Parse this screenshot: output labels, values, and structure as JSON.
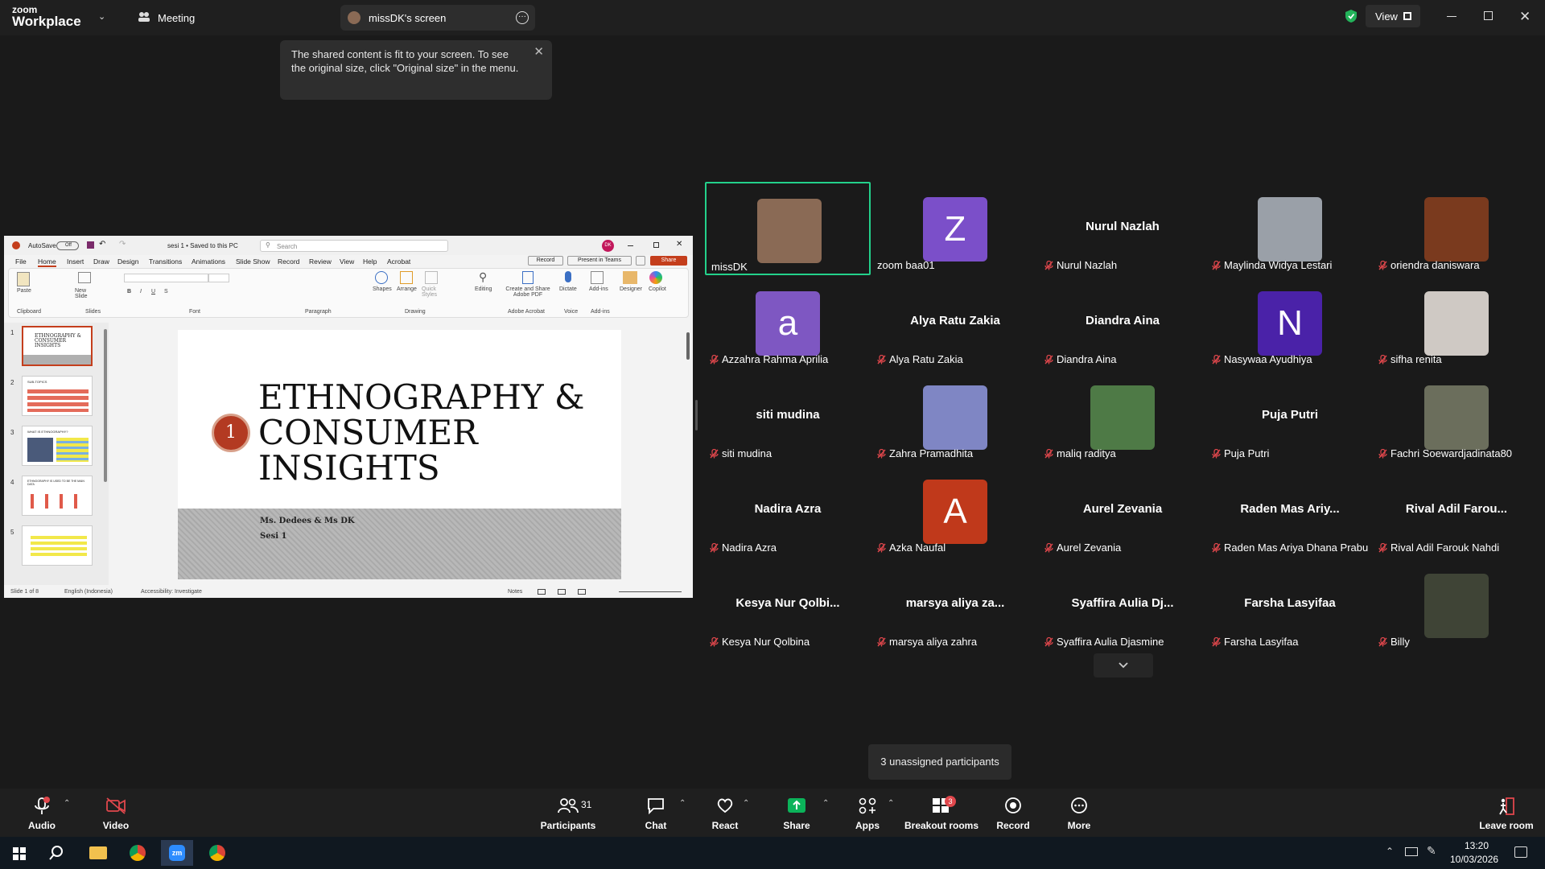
{
  "topbar": {
    "brand_small": "zoom",
    "brand_big": "Workplace",
    "meeting_label": "Meeting",
    "screen_tab": "missDK's screen",
    "view_label": "View"
  },
  "tooltip": {
    "text": "The shared content is fit to your screen. To see the original size, click \"Original size\" in the menu."
  },
  "ppt": {
    "autosave": "AutoSave",
    "autosave_state": "Off",
    "filename": "sesi 1 • Saved to this PC",
    "search_placeholder": "Search",
    "user_initials": "DK",
    "menu": [
      "File",
      "Home",
      "Insert",
      "Draw",
      "Design",
      "Transitions",
      "Animations",
      "Slide Show",
      "Record",
      "Review",
      "View",
      "Help",
      "Acrobat"
    ],
    "record_btn": "Record",
    "present_btn": "Present in Teams",
    "share_btn": "Share",
    "ribbon_groups": [
      "Clipboard",
      "Slides",
      "Font",
      "Paragraph",
      "Drawing",
      "Adobe Acrobat",
      "Voice",
      "Add-ins"
    ],
    "ribbon_buttons": [
      "Paste",
      "New Slide",
      "Shapes",
      "Arrange",
      "Quick Styles",
      "Editing",
      "Create and Share Adobe PDF",
      "Dictate",
      "Add-ins",
      "Designer",
      "Copilot"
    ],
    "thumb_numbers": [
      "1",
      "2",
      "3",
      "4",
      "5"
    ],
    "thumb_titles": [
      "ETHNOGRAPHY & CONSUMER INSIGHTS",
      "SUB-TOPICS",
      "WHAT IS ETHNOGRAPHY?",
      "ETHNOGRAPHY IS USED TO BE THE MAIN DATA",
      ""
    ],
    "slide": {
      "number": "1",
      "title_line1": "ETHNOGRAPHY &",
      "title_line2": "CONSUMER",
      "title_line3": "INSIGHTS",
      "subtitle1": "Ms. Dedees & Ms DK",
      "subtitle2": "Sesi 1"
    },
    "status": {
      "slide_count": "Slide 1 of 8",
      "language": "English (Indonesia)",
      "accessibility": "Accessibility: Investigate",
      "notes": "Notes"
    }
  },
  "participants": [
    {
      "label": "missDK",
      "type": "photo",
      "color": "#8a6a55",
      "muted": false,
      "active": true
    },
    {
      "label": "zoom baa01",
      "type": "letter",
      "letter": "Z",
      "color": "#7b4fc9",
      "muted": false
    },
    {
      "label": "Nurul Nazlah",
      "type": "name",
      "display": "Nurul Nazlah",
      "muted": true
    },
    {
      "label": "Maylinda Widya Lestari",
      "type": "photo",
      "color": "#9aa0a8",
      "muted": true
    },
    {
      "label": "oriendra daniswara",
      "type": "photo",
      "color": "#7a3a1e",
      "muted": true
    },
    {
      "label": "Azzahra Rahma Aprilia",
      "type": "letter",
      "letter": "a",
      "color": "#7e57c2",
      "muted": true
    },
    {
      "label": "Alya Ratu Zakia",
      "type": "name",
      "display": "Alya Ratu Zakia",
      "muted": true
    },
    {
      "label": "Diandra Aina",
      "type": "name",
      "display": "Diandra Aina",
      "muted": true
    },
    {
      "label": "Nasywaa Ayudhiya",
      "type": "letter",
      "letter": "N",
      "color": "#4a22a8",
      "muted": true
    },
    {
      "label": "sifha renita",
      "type": "photo",
      "color": "#cfc9c4",
      "muted": true
    },
    {
      "label": "siti mudina",
      "type": "name",
      "display": "siti mudina",
      "muted": true
    },
    {
      "label": "Zahra Pramadhita",
      "type": "letter",
      "letter": "",
      "color": "#7f86c4",
      "muted": true
    },
    {
      "label": "maliq raditya",
      "type": "photo",
      "color": "#4e7a46",
      "muted": true
    },
    {
      "label": "Puja Putri",
      "type": "name",
      "display": "Puja Putri",
      "muted": true
    },
    {
      "label": "Fachri Soewardjadinata80",
      "type": "photo",
      "color": "#6b6e5c",
      "muted": true
    },
    {
      "label": "Nadira Azra",
      "type": "name",
      "display": "Nadira Azra",
      "muted": true
    },
    {
      "label": "Azka Naufal",
      "type": "letter",
      "letter": "A",
      "color": "#c0391b",
      "muted": true
    },
    {
      "label": "Aurel Zevania",
      "type": "name",
      "display": "Aurel Zevania",
      "muted": true
    },
    {
      "label": "Raden Mas Ariya Dhana Prabu",
      "type": "name",
      "display": "Raden Mas Ariy...",
      "muted": true
    },
    {
      "label": "Rival Adil Farouk Nahdi",
      "type": "name",
      "display": "Rival Adil Farou...",
      "muted": true
    },
    {
      "label": "Kesya Nur Qolbina",
      "type": "name",
      "display": "Kesya Nur Qolbi...",
      "muted": true
    },
    {
      "label": "marsya aliya zahra",
      "type": "name",
      "display": "marsya aliya za...",
      "muted": true
    },
    {
      "label": "Syaffira Aulia Djasmine",
      "type": "name",
      "display": "Syaffira Aulia Dj...",
      "muted": true
    },
    {
      "label": "Farsha Lasyifaa",
      "type": "name",
      "display": "Farsha Lasyifaa",
      "muted": true
    },
    {
      "label": "Billy",
      "type": "photo",
      "color": "#3f4436",
      "muted": true
    }
  ],
  "unassigned": "3 unassigned participants",
  "toolbar": {
    "audio": "Audio",
    "video": "Video",
    "participants": "Participants",
    "participants_count": "31",
    "chat": "Chat",
    "react": "React",
    "share": "Share",
    "apps": "Apps",
    "breakout": "Breakout rooms",
    "breakout_badge": "3",
    "record": "Record",
    "more": "More",
    "leave": "Leave room"
  },
  "taskbar": {
    "time": "13:20",
    "date": "10/03/2026"
  },
  "colors": {
    "active_border": "#23d18b",
    "mute_red": "#e0474c",
    "share_green": "#0bb35a",
    "badge_red": "#e0474c"
  }
}
